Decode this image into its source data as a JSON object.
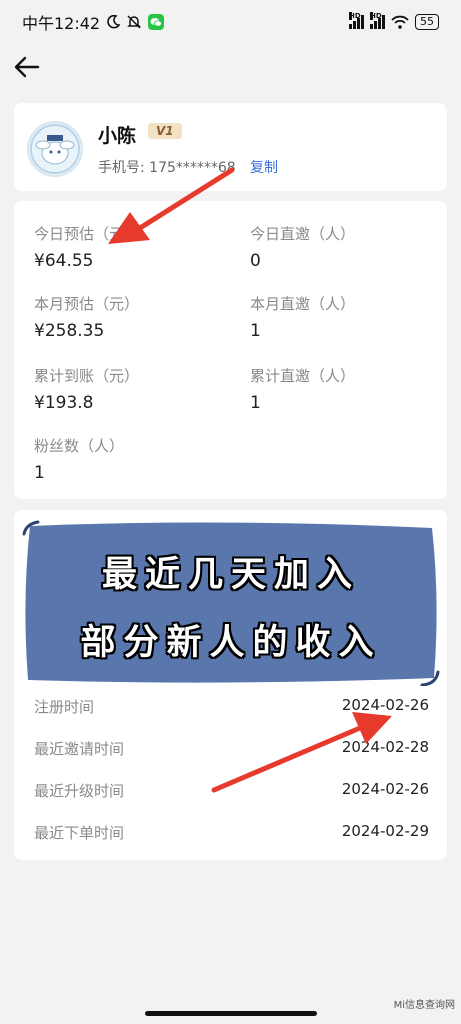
{
  "status": {
    "carrier_time": "中午12:42",
    "battery": "55"
  },
  "profile": {
    "name": "小陈",
    "level": "V1",
    "phone_label": "手机号: 175******68",
    "copy": "复制"
  },
  "stats": {
    "today_estimate_label": "今日预估（元）",
    "today_estimate_value": "¥64.55",
    "today_invite_label": "今日直邀（人）",
    "today_invite_value": "0",
    "month_estimate_label": "本月预估（元）",
    "month_estimate_value": "¥258.35",
    "month_invite_label": "本月直邀（人）",
    "month_invite_value": "1",
    "total_received_label": "累计到账（元）",
    "total_received_value": "¥193.8",
    "total_invite_label": "累计直邀（人）",
    "total_invite_value": "1",
    "fans_label": "粉丝数（人）",
    "fans_value": "1"
  },
  "overlay": {
    "line1": "最近几天加入",
    "line2": "部分新人的收入",
    "color": "#5a77ad"
  },
  "info": {
    "rows": [
      {
        "k": "注册时间",
        "v": "2024-02-26"
      },
      {
        "k": "最近邀请时间",
        "v": "2024-02-28"
      },
      {
        "k": "最近升级时间",
        "v": "2024-02-26"
      },
      {
        "k": "最近下单时间",
        "v": "2024-02-29"
      }
    ]
  },
  "watermark": "Mi信息查询网",
  "icons": {
    "back": "back-arrow-icon",
    "avatar": "avatar",
    "annotation": "red-arrow"
  },
  "colors": {
    "annotation_red": "#e63a2c",
    "link_blue": "#3b6fd6"
  }
}
